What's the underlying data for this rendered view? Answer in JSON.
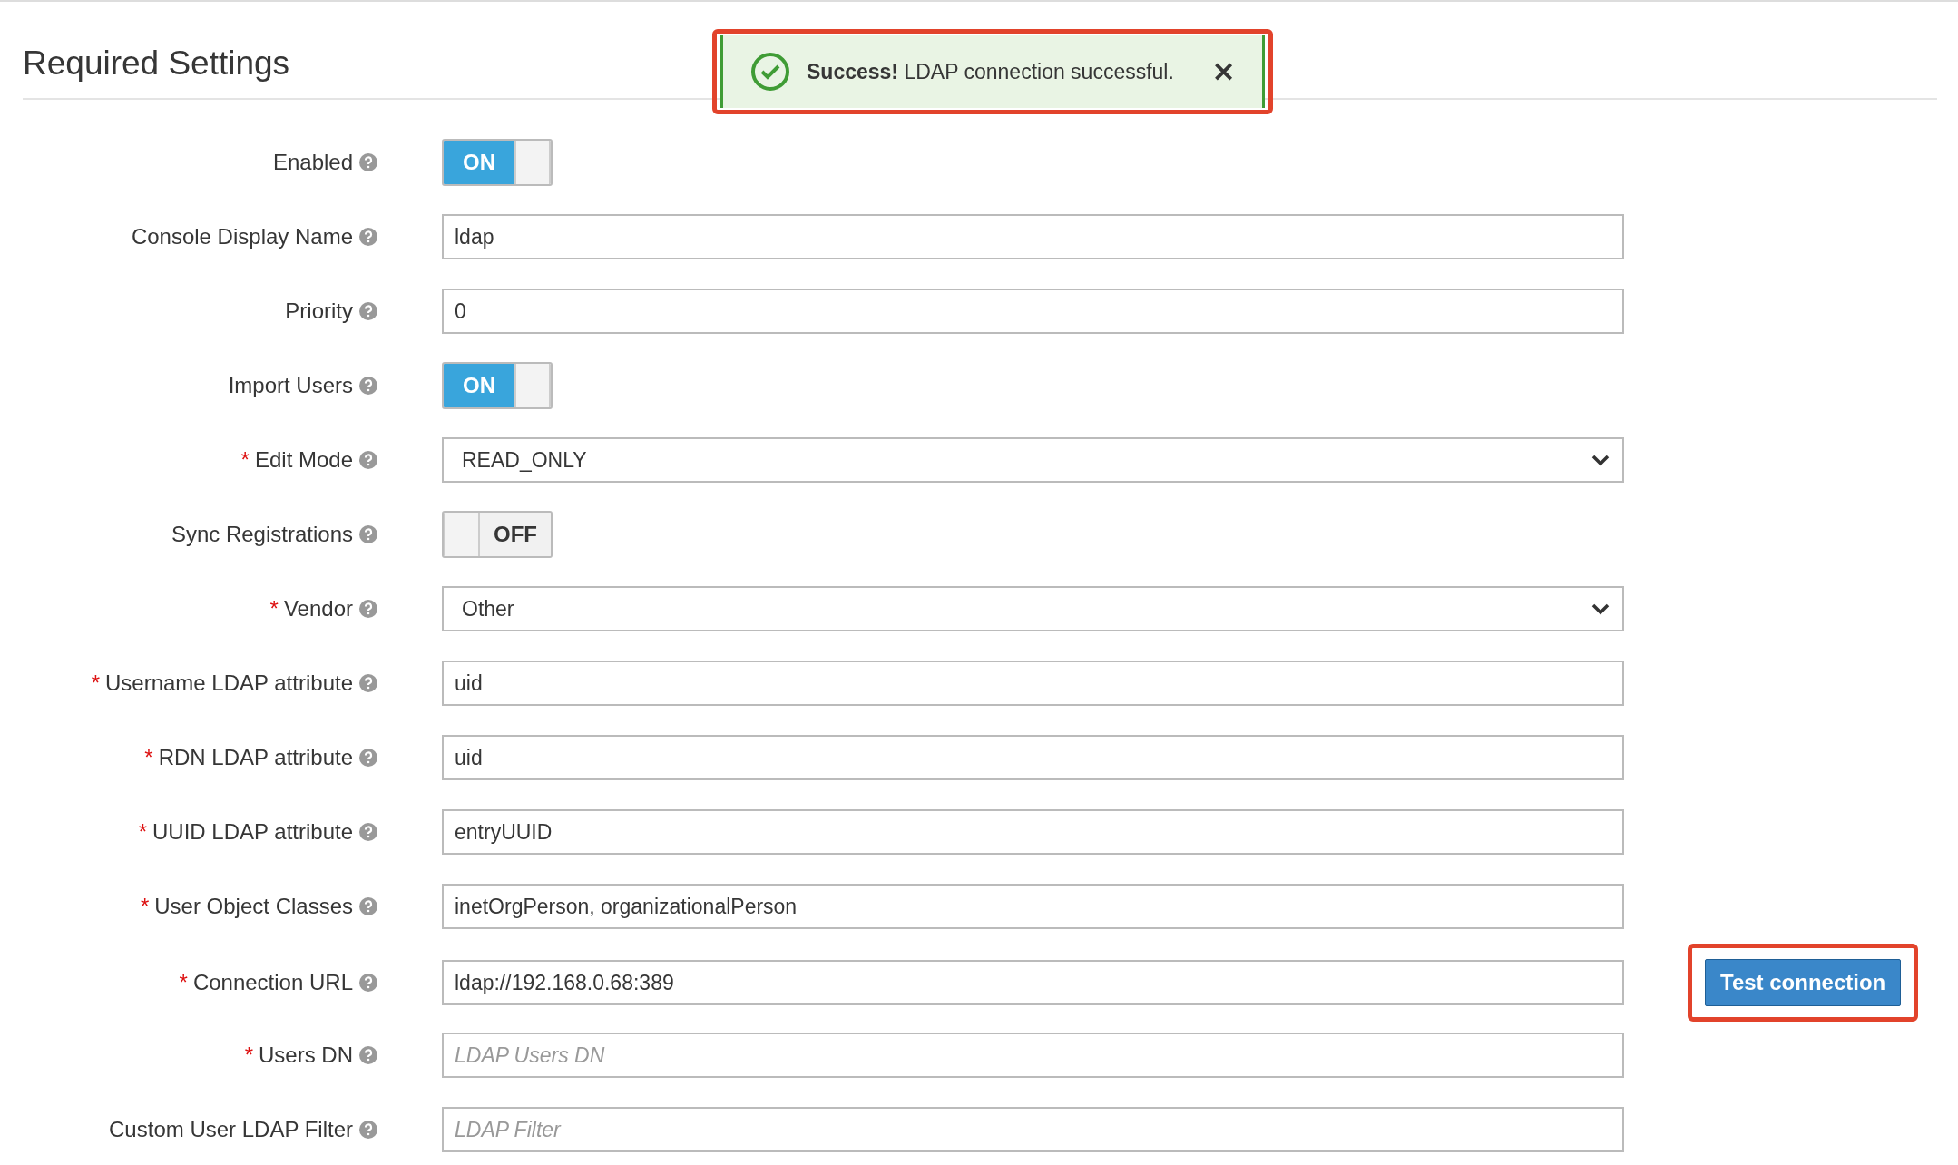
{
  "heading": "Required Settings",
  "toast": {
    "title": "Success!",
    "message": "LDAP connection successful.",
    "close": "✕",
    "highlighted": true
  },
  "fields": [
    {
      "kind": "toggle",
      "label": "Enabled",
      "on": true,
      "text": "ON"
    },
    {
      "kind": "text",
      "label": "Console Display Name",
      "value": "ldap"
    },
    {
      "kind": "text",
      "label": "Priority",
      "value": "0"
    },
    {
      "kind": "toggle",
      "label": "Import Users",
      "on": true,
      "text": "ON"
    },
    {
      "kind": "select",
      "label": "Edit Mode",
      "marker": "*",
      "value": "READ_ONLY"
    },
    {
      "kind": "toggle",
      "label": "Sync Registrations",
      "on": false,
      "text": "OFF"
    },
    {
      "kind": "select",
      "label": "Vendor",
      "marker": "*",
      "value": "Other"
    },
    {
      "kind": "text",
      "label": "Username LDAP attribute",
      "marker": "*",
      "value": "uid"
    },
    {
      "kind": "text",
      "label": "RDN LDAP attribute",
      "marker": "*",
      "value": "uid"
    },
    {
      "kind": "text",
      "label": "UUID LDAP attribute",
      "marker": "*",
      "value": "entryUUID"
    },
    {
      "kind": "text",
      "label": "User Object Classes",
      "marker": "*",
      "value": "inetOrgPerson, organizationalPerson"
    },
    {
      "kind": "text",
      "label": "Connection URL",
      "marker": "*",
      "value": "ldap://192.168.0.68:389",
      "button": {
        "label": "Test connection",
        "highlighted": true
      }
    },
    {
      "kind": "text",
      "label": "Users DN",
      "marker": "*",
      "placeholder": "LDAP Users DN"
    },
    {
      "kind": "text",
      "label": "Custom User LDAP Filter",
      "placeholder": "LDAP Filter"
    }
  ]
}
